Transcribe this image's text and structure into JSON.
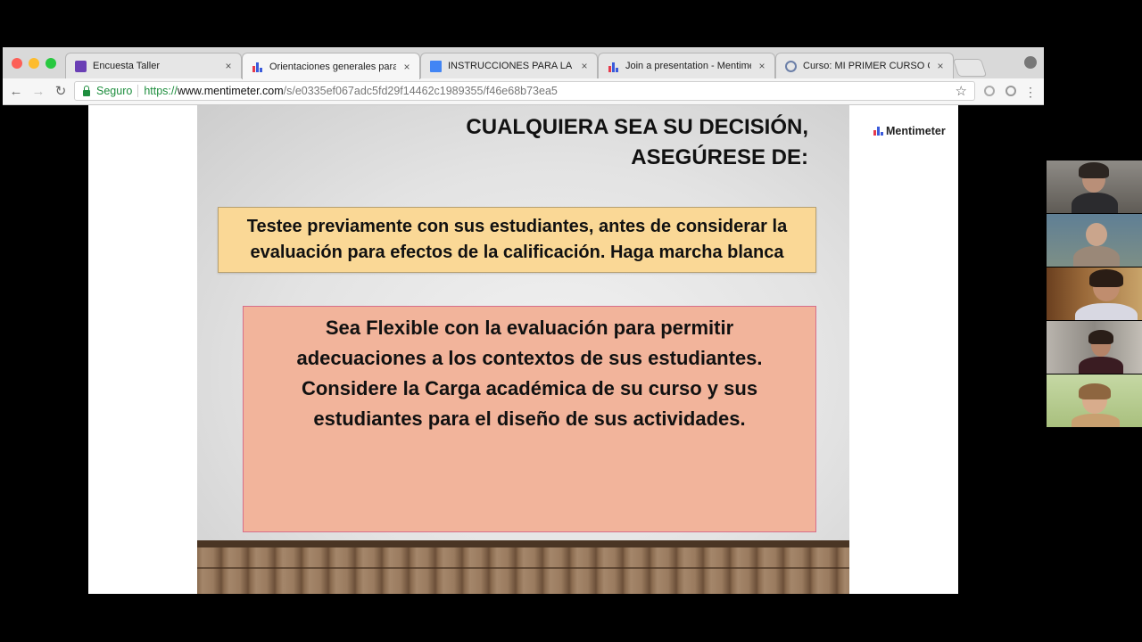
{
  "browser": {
    "tabs": [
      {
        "label": "Encuesta Taller",
        "icon": "google-forms-icon",
        "active": false
      },
      {
        "label": "Orientaciones generales para",
        "icon": "mentimeter-icon",
        "active": true
      },
      {
        "label": "INSTRUCCIONES PARA LA ES",
        "icon": "google-docs-icon",
        "active": false
      },
      {
        "label": "Join a presentation - Mentime",
        "icon": "mentimeter-icon",
        "active": false
      },
      {
        "label": "Curso: MI PRIMER CURSO CO",
        "icon": "moodle-icon",
        "active": false
      }
    ],
    "close_glyph": "×",
    "address": {
      "secure_label": "Seguro",
      "scheme": "https://",
      "host": "www.mentimeter.com",
      "path": "/s/e0335ef067adc5fd29f14462c1989355/f46e68b73ea5"
    }
  },
  "slide": {
    "heading_line1": "CUALQUIERA SEA SU DECISIÓN,",
    "heading_line2": "ASEGÚRESE DE:",
    "box1_line1": "Testee previamente con sus estudiantes, antes de considerar la",
    "box1_line2": "evaluación para efectos de la calificación. Haga marcha blanca",
    "box2_line1": "Sea Flexible con la evaluación para permitir",
    "box2_line2": "adecuaciones a los contextos de sus estudiantes.",
    "box2_line3": "Considere la Carga académica de su curso y sus",
    "box2_line4": "estudiantes para el diseño de sus actividades."
  },
  "brand": {
    "name": "Mentimeter"
  },
  "colors": {
    "box1_fill": "#fad896",
    "box2_fill": "#f2b49b",
    "box2_border": "#d76e8a",
    "secure_green": "#1e8e3e"
  },
  "participants_count": 5
}
